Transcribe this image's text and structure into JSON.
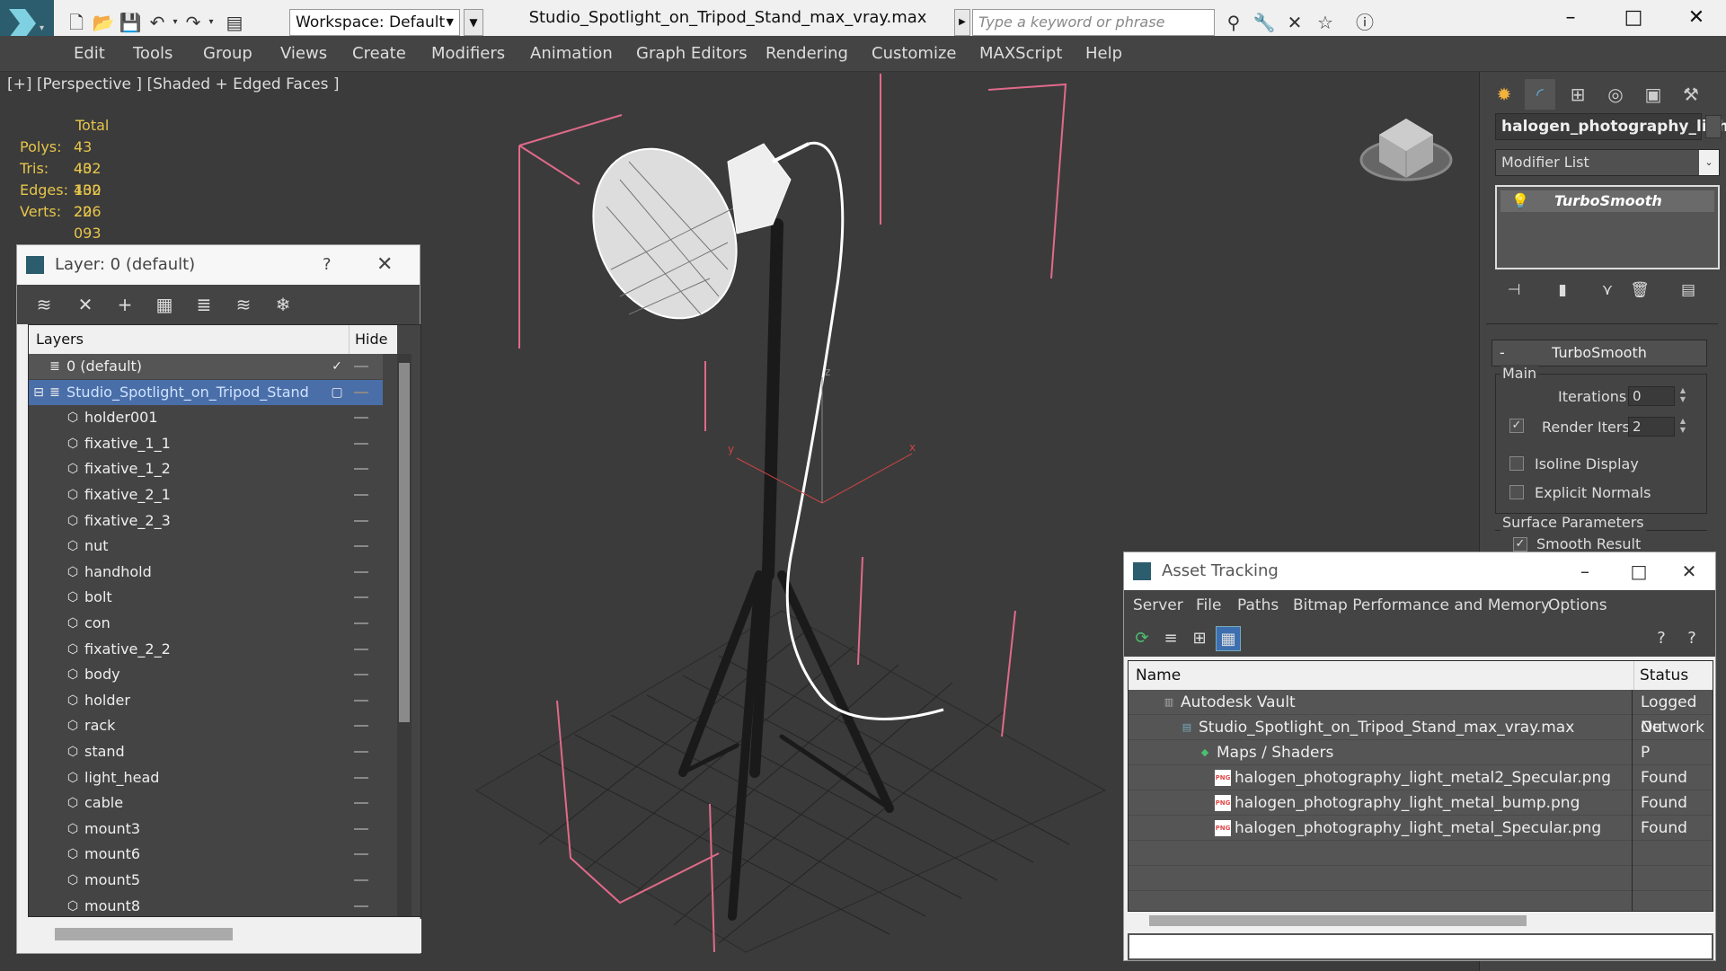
{
  "window": {
    "title": "Studio_Spotlight_on_Tripod_Stand_max_vray.max",
    "workspace": "Workspace: Default",
    "search_placeholder": "Type a keyword or phrase"
  },
  "menu": [
    "Edit",
    "Tools",
    "Group",
    "Views",
    "Create",
    "Modifiers",
    "Animation",
    "Graph Editors",
    "Rendering",
    "Customize",
    "MAXScript",
    "Help"
  ],
  "viewport": {
    "label": "[+] [Perspective ] [Shaded + Edged Faces ]"
  },
  "stats": {
    "header": "Total",
    "rows": [
      {
        "label": "Polys:",
        "value": "43 402"
      },
      {
        "label": "Tris:",
        "value": "43 402"
      },
      {
        "label": "Edges:",
        "value": "130 206"
      },
      {
        "label": "Verts:",
        "value": "22 093"
      }
    ]
  },
  "layer_panel": {
    "title": "Layer: 0 (default)",
    "help": "?",
    "col_layers": "Layers",
    "col_hide": "Hide",
    "rows": [
      {
        "name": "0 (default)",
        "level": 0,
        "type": "layer"
      },
      {
        "name": "Studio_Spotlight_on_Tripod_Stand",
        "level": 0,
        "type": "layer",
        "selected": true
      },
      {
        "name": "holder001",
        "level": 1
      },
      {
        "name": "fixative_1_1",
        "level": 1
      },
      {
        "name": "fixative_1_2",
        "level": 1
      },
      {
        "name": "fixative_2_1",
        "level": 1
      },
      {
        "name": "fixative_2_3",
        "level": 1
      },
      {
        "name": "nut",
        "level": 1
      },
      {
        "name": "handhold",
        "level": 1
      },
      {
        "name": "bolt",
        "level": 1
      },
      {
        "name": "con",
        "level": 1
      },
      {
        "name": "fixative_2_2",
        "level": 1
      },
      {
        "name": "body",
        "level": 1
      },
      {
        "name": "holder",
        "level": 1
      },
      {
        "name": "rack",
        "level": 1
      },
      {
        "name": "stand",
        "level": 1
      },
      {
        "name": "light_head",
        "level": 1
      },
      {
        "name": "cable",
        "level": 1
      },
      {
        "name": "mount3",
        "level": 1
      },
      {
        "name": "mount6",
        "level": 1
      },
      {
        "name": "mount5",
        "level": 1
      },
      {
        "name": "mount8",
        "level": 1
      }
    ]
  },
  "command_panel": {
    "object_name": "halogen_photography_light",
    "modifier_list": "Modifier List",
    "stack_item": "TurboSmooth",
    "rollout": "TurboSmooth",
    "rollout_toggle": "-",
    "main_label": "Main",
    "iterations_label": "Iterations:",
    "iterations": "0",
    "render_iters_label": "Render Iters:",
    "render_iters": "2",
    "isoline": "Isoline Display",
    "explicit_normals": "Explicit Normals",
    "surface_params": "Surface Parameters",
    "smooth_result": "Smooth Result"
  },
  "asset_tracking": {
    "title": "Asset Tracking",
    "menu": [
      "Server",
      "File",
      "Paths",
      "Bitmap Performance and Memory",
      "Options"
    ],
    "col_name": "Name",
    "col_status": "Status",
    "rows": [
      {
        "name": "Autodesk Vault",
        "status": "Logged Ou",
        "indent": 1
      },
      {
        "name": "Studio_Spotlight_on_Tripod_Stand_max_vray.max",
        "status": "Network P",
        "indent": 2
      },
      {
        "name": "Maps / Shaders",
        "status": "",
        "indent": 3
      },
      {
        "name": "halogen_photography_light_metal2_Specular.png",
        "status": "Found",
        "indent": 4
      },
      {
        "name": "halogen_photography_light_metal_bump.png",
        "status": "Found",
        "indent": 4
      },
      {
        "name": "halogen_photography_light_metal_Specular.png",
        "status": "Found",
        "indent": 4
      }
    ]
  },
  "axis": {
    "x": "x",
    "y": "y",
    "z": "z"
  },
  "icons": {
    "layer_tools": [
      "new-layer-icon",
      "delete-icon",
      "add-icon",
      "select-icon",
      "highlight-icon",
      "hide-all-icon",
      "freeze-all-icon"
    ],
    "asset_tools": [
      "refresh-icon",
      "list-icon",
      "tree-icon",
      "table-icon"
    ],
    "cmd_tabs": [
      "create-icon",
      "modify-icon",
      "hierarchy-icon",
      "motion-icon",
      "display-icon",
      "utilities-icon"
    ],
    "stack_tools": [
      "pin-stack-icon",
      "show-end-result-icon",
      "make-unique-icon",
      "remove-modifier-icon",
      "configure-sets-icon"
    ]
  }
}
